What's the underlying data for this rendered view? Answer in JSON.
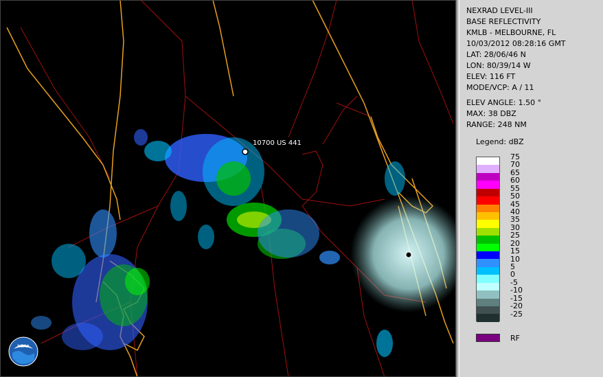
{
  "info": {
    "product": "NEXRAD LEVEL-III",
    "type": "BASE REFLECTIVITY",
    "station": "KMLB - MELBOURNE, FL",
    "datetime": "10/03/2012 08:28:16 GMT",
    "lat": "LAT: 28/06/46 N",
    "lon": "LON: 80/39/14 W",
    "elev": "ELEV: 116 FT",
    "mode": "MODE/VCP: A / 11",
    "elev_angle": "ELEV ANGLE: 1.50 °",
    "max": "MAX: 38 DBZ",
    "range": "RANGE: 248 NM"
  },
  "legend": {
    "title": "Legend: dBZ",
    "labels": [
      "75",
      "70",
      "65",
      "60",
      "55",
      "50",
      "45",
      "40",
      "35",
      "30",
      "25",
      "20",
      "15",
      "10",
      "5",
      "0",
      "-5",
      "-10",
      "-15",
      "-20",
      "-25"
    ],
    "colors": [
      "#ffffff",
      "#e0b0ff",
      "#c000c0",
      "#ff00ff",
      "#c00000",
      "#ff0000",
      "#ff8000",
      "#ffc000",
      "#ffff00",
      "#a0e000",
      "#00c000",
      "#00ff00",
      "#0000ff",
      "#3090ff",
      "#00c0ff",
      "#80ffff",
      "#c0ffff",
      "#90c0c0",
      "#608080",
      "#405050",
      "#203030"
    ],
    "rf_label": "RF",
    "rf_color": "#7a0080"
  },
  "map": {
    "site_label": "10700 US 441",
    "logo_text": "NOAA"
  }
}
